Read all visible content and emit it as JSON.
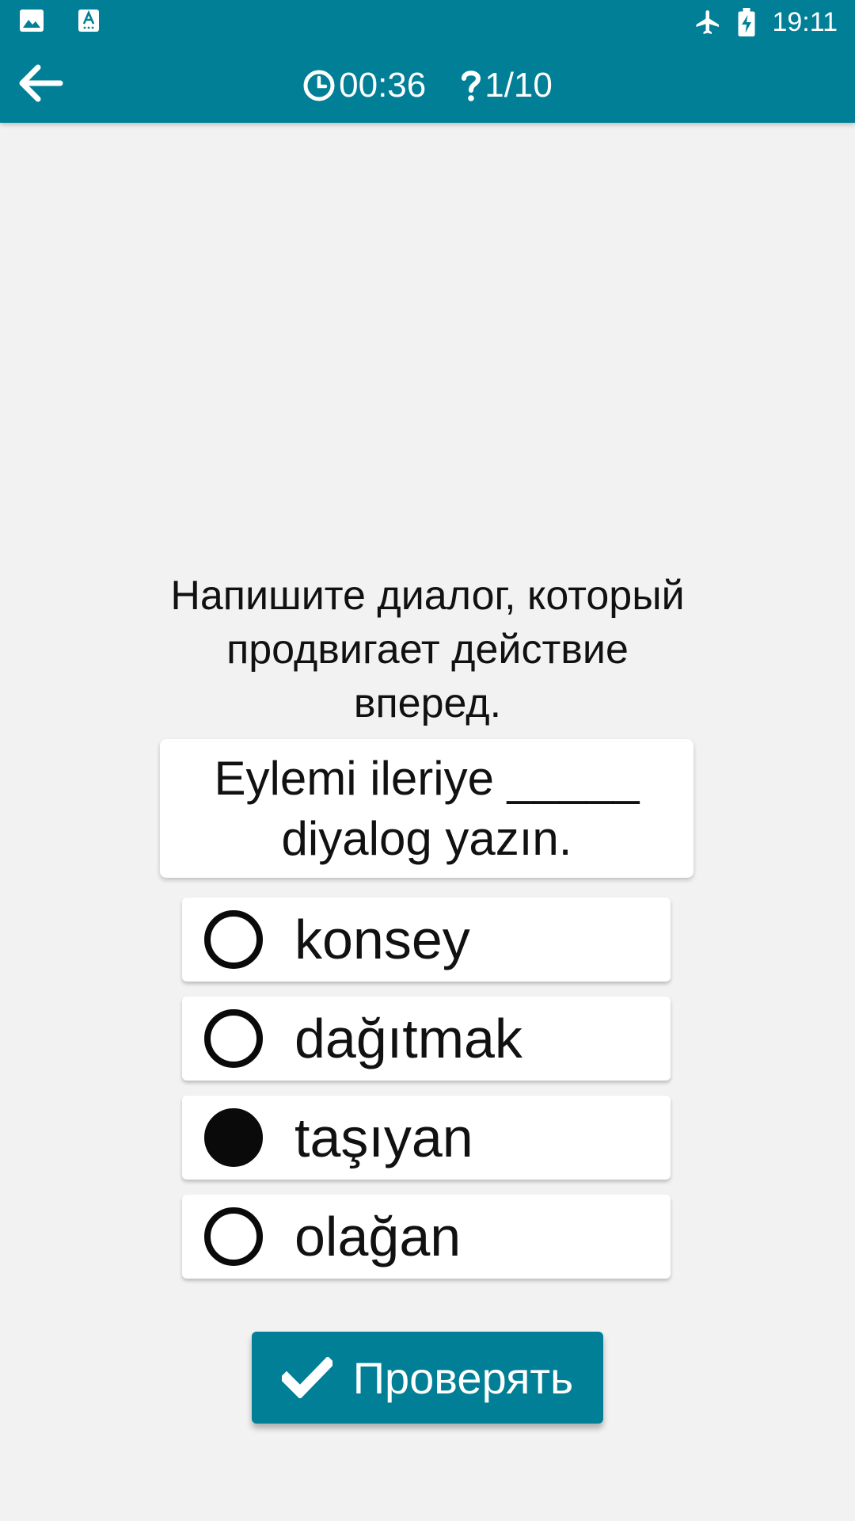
{
  "status_bar": {
    "time": "19:11",
    "icons": [
      "image-icon",
      "font-icon",
      "airplane-icon",
      "battery-charging-icon"
    ]
  },
  "header": {
    "timer": "00:36",
    "progress": "1/10",
    "icons": [
      "back-arrow-icon",
      "clock-icon",
      "question-mark-icon"
    ]
  },
  "prompt_text": "Напишите диалог, который продвигает действие вперед.",
  "question_lines": [
    "Eylemi ileriye _____",
    "diyalog yazın."
  ],
  "options": [
    {
      "label": "konsey",
      "selected": false
    },
    {
      "label": "dağıtmak",
      "selected": false
    },
    {
      "label": "taşıyan",
      "selected": true
    },
    {
      "label": "olağan",
      "selected": false
    }
  ],
  "check_button": {
    "label": "Проверять",
    "icon": "checkmark-icon"
  },
  "colors": {
    "primary": "#007f96",
    "background": "#f2f2f2",
    "card": "#ffffff",
    "text": "#111111"
  }
}
